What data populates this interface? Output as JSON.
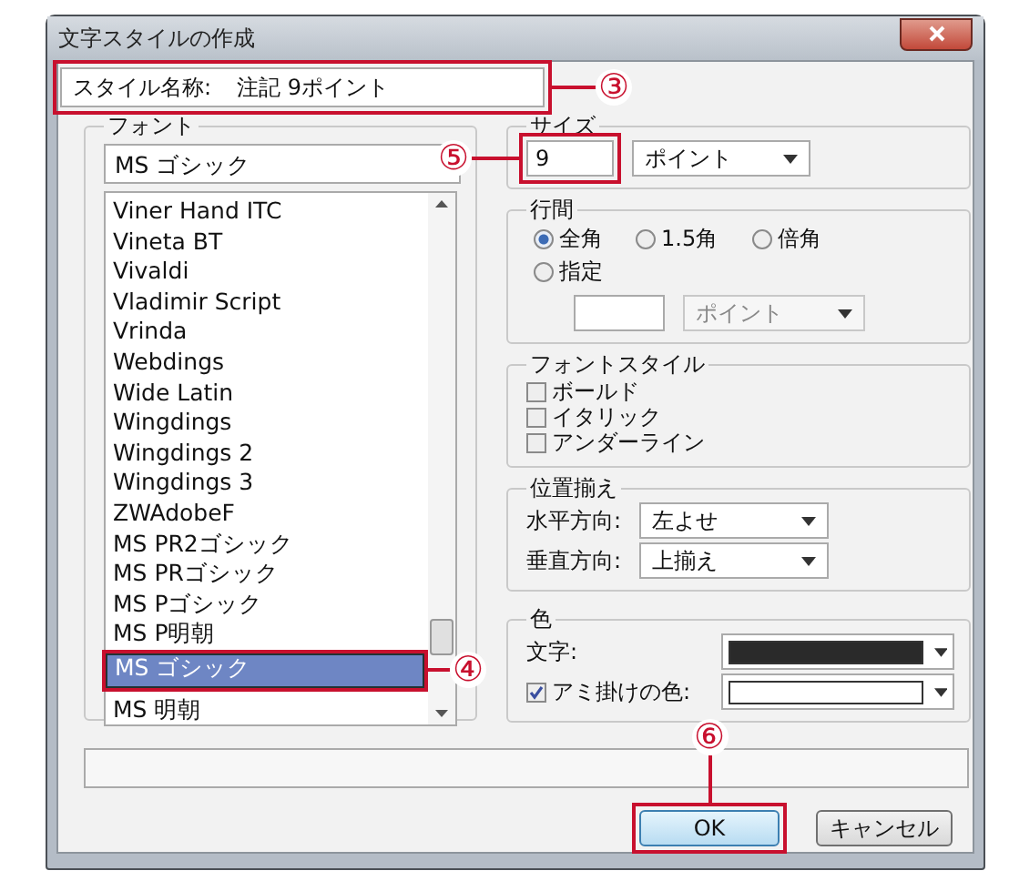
{
  "window": {
    "title": "文字スタイルの作成"
  },
  "style_name": {
    "label": "スタイル名称:",
    "value": "注記 9ポイント"
  },
  "font_group": {
    "legend": "フォント",
    "value": "MS ゴシック",
    "items": [
      {
        "label": "Viner Hand ITC",
        "selected": false
      },
      {
        "label": "Vineta BT",
        "selected": false
      },
      {
        "label": "Vivaldi",
        "selected": false
      },
      {
        "label": "Vladimir Script",
        "selected": false
      },
      {
        "label": "Vrinda",
        "selected": false
      },
      {
        "label": "Webdings",
        "selected": false
      },
      {
        "label": "Wide Latin",
        "selected": false
      },
      {
        "label": "Wingdings",
        "selected": false
      },
      {
        "label": "Wingdings 2",
        "selected": false
      },
      {
        "label": "Wingdings 3",
        "selected": false
      },
      {
        "label": "ZWAdobeF",
        "selected": false
      },
      {
        "label": "MS PR2ゴシック",
        "selected": false
      },
      {
        "label": "MS PRゴシック",
        "selected": false
      },
      {
        "label": "MS Pゴシック",
        "selected": false
      },
      {
        "label": "MS P明朝",
        "selected": false
      },
      {
        "label": "MS ゴシック",
        "selected": true
      },
      {
        "label": "MS 明朝",
        "selected": false
      }
    ]
  },
  "size_group": {
    "legend": "サイズ",
    "value": "9",
    "unit": "ポイント"
  },
  "line_spacing": {
    "legend": "行間",
    "options": [
      {
        "label": "全角",
        "selected": true
      },
      {
        "label": "1.5角",
        "selected": false
      },
      {
        "label": "倍角",
        "selected": false
      },
      {
        "label": "指定",
        "selected": false
      }
    ],
    "unit": {
      "value": "ポイント",
      "disabled": true
    }
  },
  "font_style": {
    "legend": "フォントスタイル",
    "options": [
      {
        "label": "ボールド",
        "checked": false
      },
      {
        "label": "イタリック",
        "checked": false
      },
      {
        "label": "アンダーライン",
        "checked": false
      }
    ]
  },
  "alignment": {
    "legend": "位置揃え",
    "rows": [
      {
        "label": "水平方向:",
        "value": "左よせ"
      },
      {
        "label": "垂直方向:",
        "value": "上揃え"
      }
    ]
  },
  "color": {
    "legend": "色",
    "rows": [
      {
        "kind": "plain",
        "label": "文字:",
        "color": "#2a2a2a"
      },
      {
        "kind": "checkbox",
        "label": "アミ掛けの色:",
        "checked": true,
        "color": "#ffffff"
      }
    ]
  },
  "buttons": [
    {
      "label": "OK",
      "default": true
    },
    {
      "label": "キャンセル",
      "default": false
    }
  ],
  "callouts": [
    {
      "label": "③"
    },
    {
      "label": "④"
    },
    {
      "label": "⑤"
    },
    {
      "label": "⑥"
    }
  ]
}
